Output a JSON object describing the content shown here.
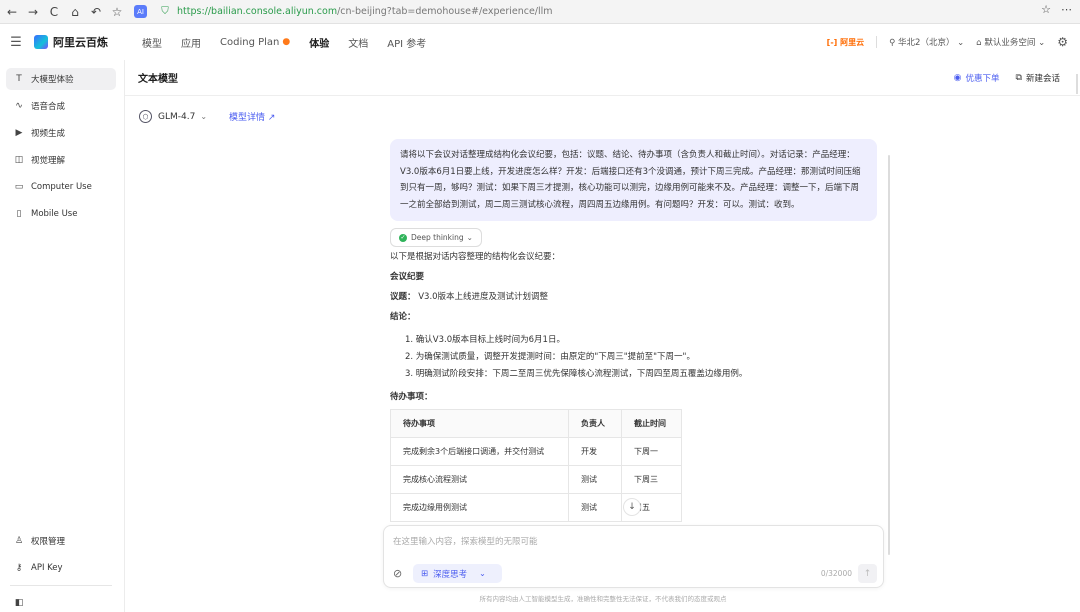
{
  "browser": {
    "url_host": "https://bailian.console.aliyun.com",
    "url_rest": "/cn-beijing?tab=demohouse#/experience/llm",
    "ext_badge": "AI"
  },
  "header": {
    "brand": "阿里云百炼",
    "nav": [
      {
        "label": "模型"
      },
      {
        "label": "应用"
      },
      {
        "label": "Coding Plan"
      },
      {
        "label": "体验"
      },
      {
        "label": "文档"
      },
      {
        "label": "API 参考"
      }
    ],
    "aliyun": "[-] 阿里云",
    "region": "华北2（北京）",
    "workspace": "默认业务空间"
  },
  "sidebar": {
    "items": [
      {
        "label": "大模型体验",
        "icon": "T"
      },
      {
        "label": "语音合成",
        "icon": "∿"
      },
      {
        "label": "视频生成",
        "icon": "▶"
      },
      {
        "label": "视觉理解",
        "icon": "◫"
      },
      {
        "label": "Computer Use",
        "icon": "▭"
      },
      {
        "label": "Mobile Use",
        "icon": "▯"
      }
    ],
    "bottom": [
      {
        "label": "权限管理",
        "icon": "♙"
      },
      {
        "label": "API Key",
        "icon": "⚷"
      }
    ]
  },
  "main": {
    "title": "文本模型",
    "coupon": "优惠下单",
    "new_chat": "新建会话",
    "model_name": "GLM-4.7",
    "model_detail": "模型详情 ↗"
  },
  "conversation": {
    "user_message": "请将以下会议对话整理成结构化会议纪要，包括：议题、结论、待办事项（含负责人和截止时间）。对话记录：产品经理：V3.0版本6月1日要上线，开发进度怎么样？开发：后端接口还有3个没调通，预计下周三完成。产品经理：那测试时间压缩到只有一周，够吗？测试：如果下周三才提测，核心功能可以测完，边缘用例可能来不及。产品经理：调整一下，后端下周一之前全部给到测试，周二周三测试核心流程，周四周五边缘用例。有问题吗？开发：可以。测试：收到。",
    "deep_thinking": "Deep thinking",
    "intro": "以下是根据对话内容整理的结构化会议纪要：",
    "minutes_title": "会议纪要",
    "topic_label": "议题：",
    "topic_value": "V3.0版本上线进度及测试计划调整",
    "conclusion_label": "结论：",
    "conclusions": [
      "1. 确认V3.0版本目标上线时间为6月1日。",
      "2. 为确保测试质量，调整开发提测时间：由原定的\"下周三\"提前至\"下周一\"。",
      "3. 明确测试阶段安排：下周二至周三优先保障核心流程测试，下周四至周五覆盖边缘用例。"
    ],
    "todo_label": "待办事项：",
    "todo_headers": [
      "待办事项",
      "负责人",
      "截止时间"
    ],
    "todo_rows": [
      [
        "完成剩余3个后端接口调通，并交付测试",
        "开发",
        "下周一"
      ],
      [
        "完成核心流程测试",
        "测试",
        "下周三"
      ],
      [
        "完成边缘用例测试",
        "测试",
        "周五"
      ]
    ]
  },
  "input": {
    "placeholder": "在这里输入内容，探索模型的无限可能",
    "deep_think": "深度思考",
    "char_count": "0/32000"
  },
  "disclaimer": "所有内容均由人工智能模型生成，准确性和完整性无法保证，不代表我们的态度或观点"
}
